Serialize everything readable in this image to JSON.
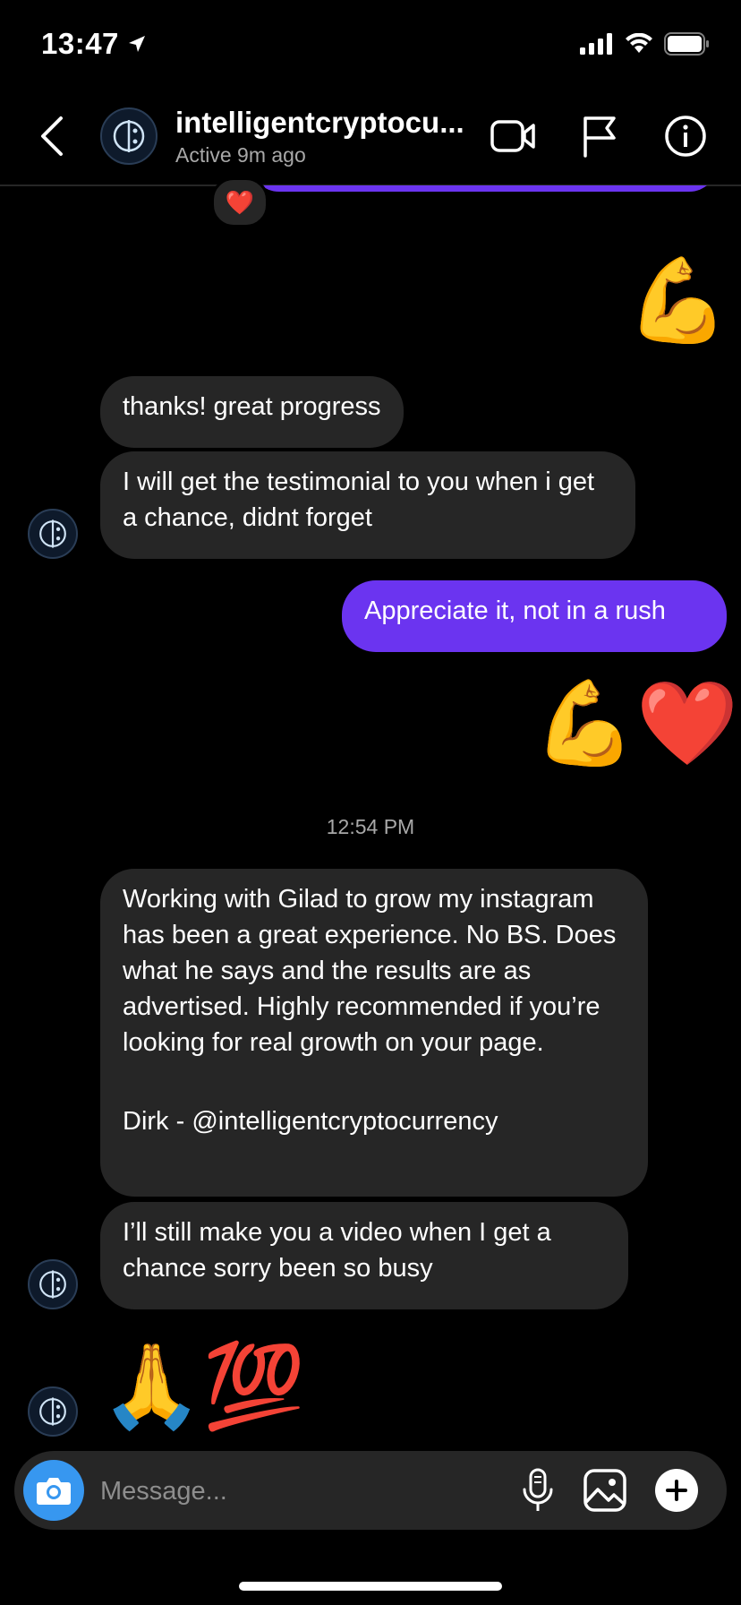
{
  "status_bar": {
    "time": "13:47"
  },
  "header": {
    "username": "intelligentcryptocu...",
    "active_status": "Active 9m ago"
  },
  "messages": {
    "reaction_heart": "❤️",
    "sent_flex": "💪",
    "recv_1": "thanks! great progress",
    "recv_2": "I will get the testimonial to you when i get a chance, didnt forget",
    "sent_1": "Appreciate it, not in a rush",
    "sent_emojis": "💪❤️",
    "timestamp": "12:54 PM",
    "testimonial_body": "Working with Gilad to grow my instagram has been a great experience. No BS. Does what he says and the results are as advertised. Highly recommended if you’re looking for real growth on your page.",
    "testimonial_sig": "Dirk - @intelligentcryptocurrency",
    "recv_3": "I’ll still make you a video when I get a chance sorry been so busy",
    "recv_emojis": "🙏💯"
  },
  "composer": {
    "placeholder": "Message..."
  },
  "colors": {
    "sent_bubble": "#6b34f0",
    "received_bubble": "#262626",
    "camera_button": "#3797f0"
  }
}
